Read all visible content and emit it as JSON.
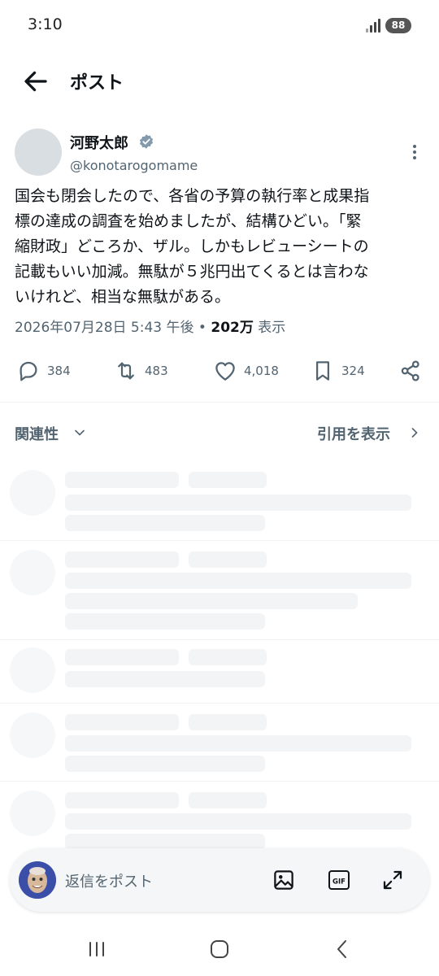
{
  "status_bar": {
    "time": "3:10",
    "battery": "88",
    "signal_icon": "signal-icon"
  },
  "header": {
    "back_icon": "arrow-left-icon",
    "title": "ポスト"
  },
  "post": {
    "display_name": "河野太郎",
    "verified_icon": "verified-badge-icon",
    "handle": "@konotarogomame",
    "more_icon": "more-vertical-icon",
    "text_lines": [
      "国会も閉会したので、各省の予算の執行率と成果指",
      "標の達成の調査を始めましたが、結構ひどい。「緊",
      "縮財政」どころか、ザル。しかもレビューシートの",
      "記載もいい加減。無駄が５兆円出てくるとは言わな",
      "いけれど、相当な無駄がある。"
    ],
    "timestamp": "2026年07月28日 5:43 午後",
    "separator": " • ",
    "views_count": "202万",
    "views_label": " 表示"
  },
  "actions": {
    "reply": {
      "icon": "reply-icon",
      "count": "384"
    },
    "repost": {
      "icon": "repost-icon",
      "count": "483"
    },
    "like": {
      "icon": "heart-icon",
      "count": "4,018"
    },
    "bookmark": {
      "icon": "bookmark-icon",
      "count": "324"
    },
    "share": {
      "icon": "share-icon"
    }
  },
  "replies_header": {
    "sort_label": "関連性",
    "quotes_label": "引用を表示"
  },
  "reply_composer": {
    "placeholder": "返信をポスト",
    "image_icon": "image-icon",
    "gif_icon": "gif-icon",
    "gif_label": "GIF",
    "expand_icon": "expand-icon"
  },
  "system_nav": {
    "recents_icon": "recents-icon",
    "home_icon": "home-icon",
    "back_icon": "back-chevron-icon"
  },
  "colors": {
    "text_primary": "#0f1419",
    "text_secondary": "#536471",
    "verified": "#829aab",
    "skeleton": "#f2f4f5"
  }
}
